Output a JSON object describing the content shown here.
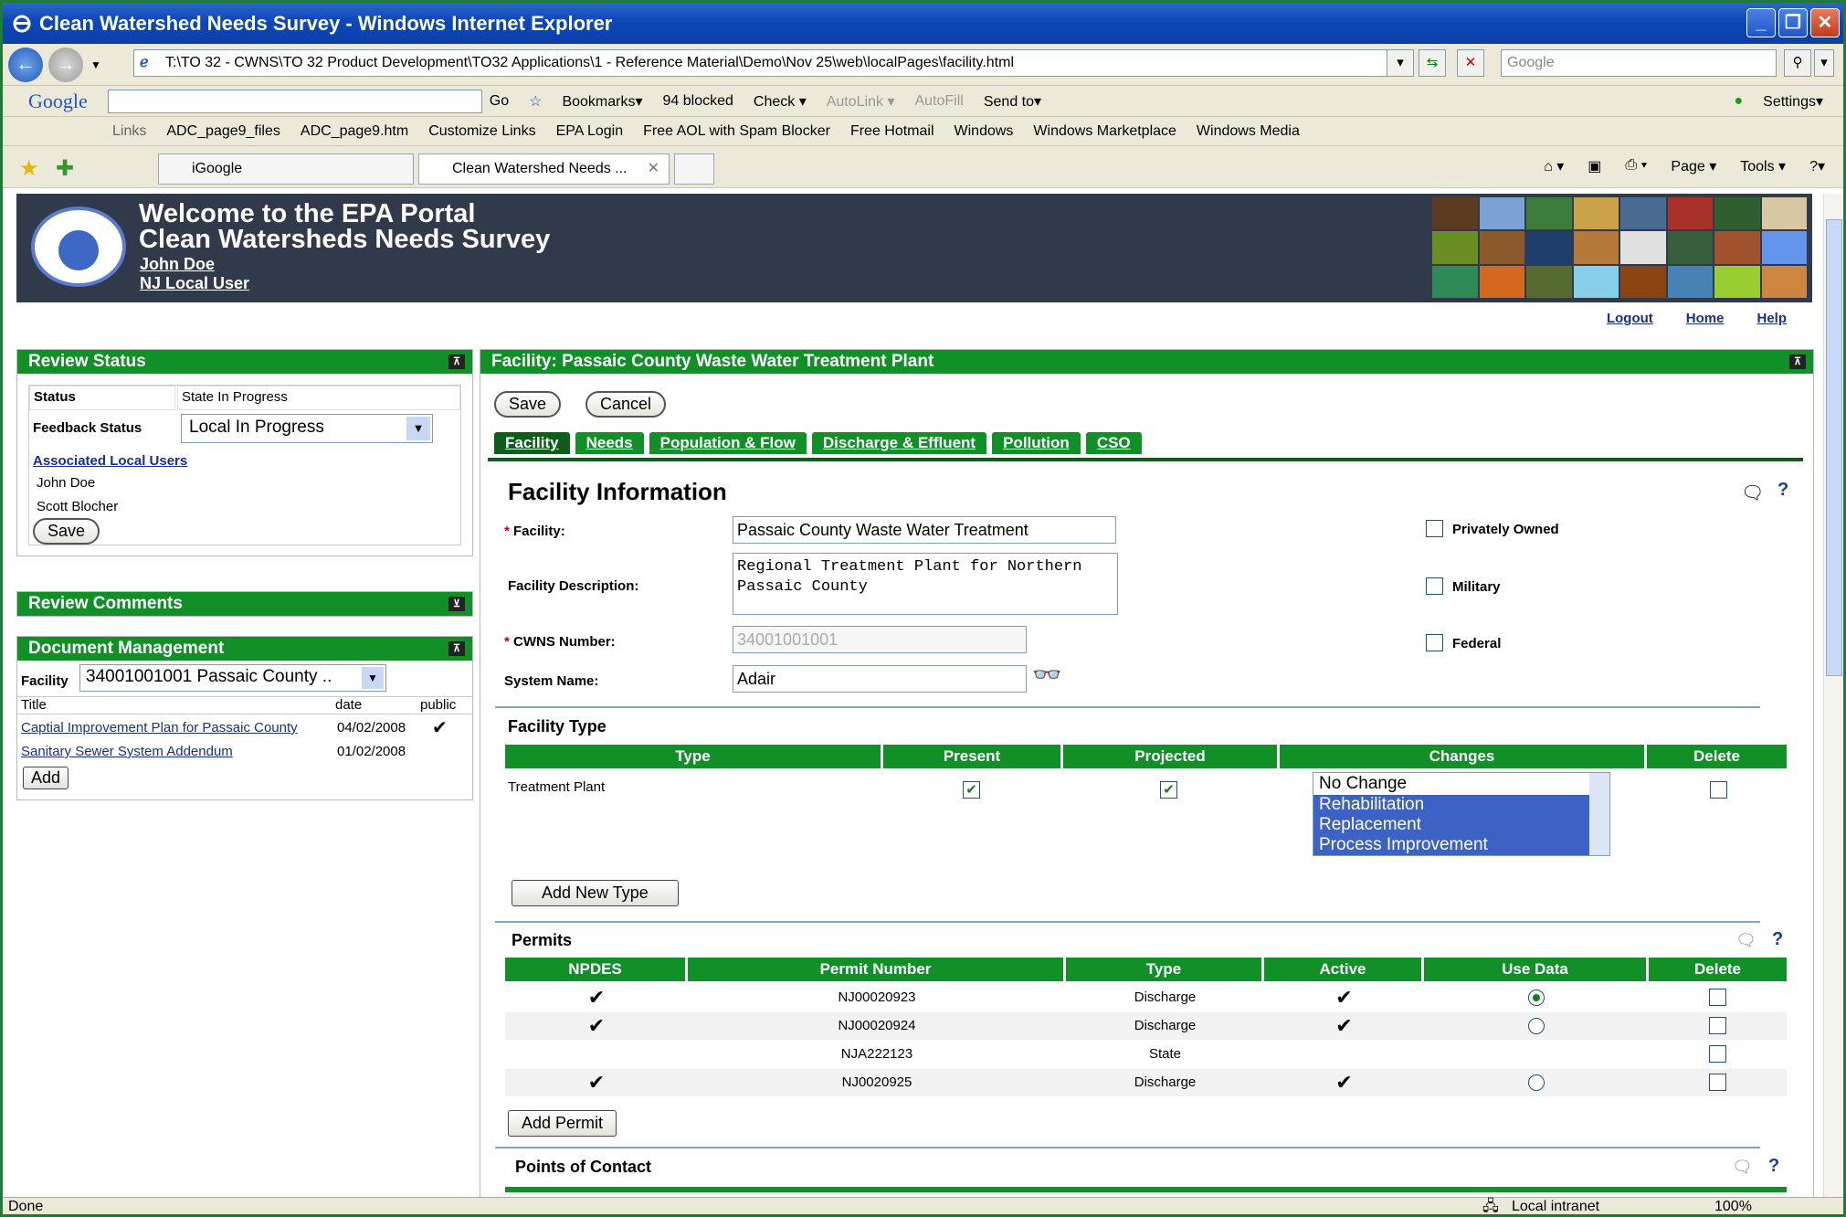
{
  "window": {
    "title": "Clean Watershed Needs Survey - Windows Internet Explorer"
  },
  "address": {
    "url": "T:\\TO 32 - CWNS\\TO 32 Product Development\\TO32 Applications\\1 - Reference Material\\Demo\\Nov 25\\web\\localPages\\facility.html",
    "search_placeholder": "Google"
  },
  "googlebar": {
    "brand": "Google",
    "go": "Go",
    "bookmarks": "Bookmarks▾",
    "blocked": "94 blocked",
    "check": "Check ▾",
    "autolink": "AutoLink ▾",
    "autofill": "AutoFill",
    "sendto": "Send to▾",
    "settings": "Settings▾"
  },
  "links": {
    "label": "Links",
    "items": [
      "ADC_page9_files",
      "ADC_page9.htm",
      "Customize Links",
      "EPA Login",
      "Free AOL with Spam Blocker",
      "Free Hotmail",
      "Windows",
      "Windows Marketplace",
      "Windows Media"
    ]
  },
  "tabs_browser": [
    {
      "label": "iGoogle"
    },
    {
      "label": "Clean Watershed Needs ..."
    }
  ],
  "commands": {
    "page": "Page ▾",
    "tools": "Tools ▾"
  },
  "banner": {
    "line1": "Welcome to the EPA Portal",
    "line2": "Clean Watersheds Needs Survey",
    "user": "John Doe",
    "role": "NJ Local User"
  },
  "toplinks": {
    "logout": "Logout",
    "home": "Home",
    "help": "Help"
  },
  "review_status": {
    "title": "Review Status",
    "status_label": "Status",
    "status_value": "State In Progress",
    "feedback_label": "Feedback Status",
    "feedback_value": "Local In Progress",
    "assoc_label": "Associated Local Users",
    "users": [
      "John Doe",
      "Scott Blocher"
    ],
    "save": "Save"
  },
  "review_comments": {
    "title": "Review Comments"
  },
  "docs": {
    "title": "Document Management",
    "facility_label": "Facility",
    "facility_value": "34001001001 Passaic County ..",
    "headers": [
      "Title",
      "date",
      "public"
    ],
    "rows": [
      {
        "title": "Captial Improvement Plan for Passaic County",
        "date": "04/02/2008",
        "public": "✔"
      },
      {
        "title": "Sanitary Sewer System Addendum",
        "date": "01/02/2008",
        "public": ""
      }
    ],
    "add": "Add"
  },
  "facility": {
    "title": "Facility: Passaic County Waste Water Treatment Plant",
    "save": "Save",
    "cancel": "Cancel",
    "tabs": [
      "Facility",
      "Needs",
      "Population & Flow",
      "Discharge & Effluent",
      "Pollution",
      "CSO"
    ],
    "heading": "Facility Information",
    "facility_label": "Facility:",
    "facility_value": "Passaic County Waste Water Treatment",
    "desc_label": "Facility Description:",
    "desc_value": "Regional Treatment Plant for Northern Passaic County",
    "cwns_label": "CWNS Number:",
    "cwns_value": "34001001001",
    "system_label": "System Name:",
    "system_value": "Adair",
    "privately_owned": "Privately Owned",
    "military": "Military",
    "federal": "Federal",
    "type_section": "Facility Type",
    "type_headers": [
      "Type",
      "Present",
      "Projected",
      "Changes",
      "Delete"
    ],
    "type_row": {
      "type": "Treatment Plant",
      "changes": [
        "No Change",
        "Rehabilitation",
        "Replacement",
        "Process Improvement"
      ]
    },
    "add_type": "Add New Type",
    "permits_section": "Permits",
    "permit_headers": [
      "NPDES",
      "Permit Number",
      "Type",
      "Active",
      "Use Data",
      "Delete"
    ],
    "permits": [
      {
        "npdes": "✔",
        "number": "NJ00020923",
        "type": "Discharge",
        "active": "✔",
        "use": true
      },
      {
        "npdes": "✔",
        "number": "NJ00020924",
        "type": "Discharge",
        "active": "✔",
        "use": false
      },
      {
        "npdes": "",
        "number": "NJA222123",
        "type": "State",
        "active": "",
        "use": null
      },
      {
        "npdes": "✔",
        "number": "NJ0020925",
        "type": "Discharge",
        "active": "✔",
        "use": false
      }
    ],
    "add_permit": "Add Permit",
    "contacts_section": "Points of Contact"
  },
  "status": {
    "left": "Done",
    "zone": "Local intranet",
    "zoom": "100%"
  }
}
